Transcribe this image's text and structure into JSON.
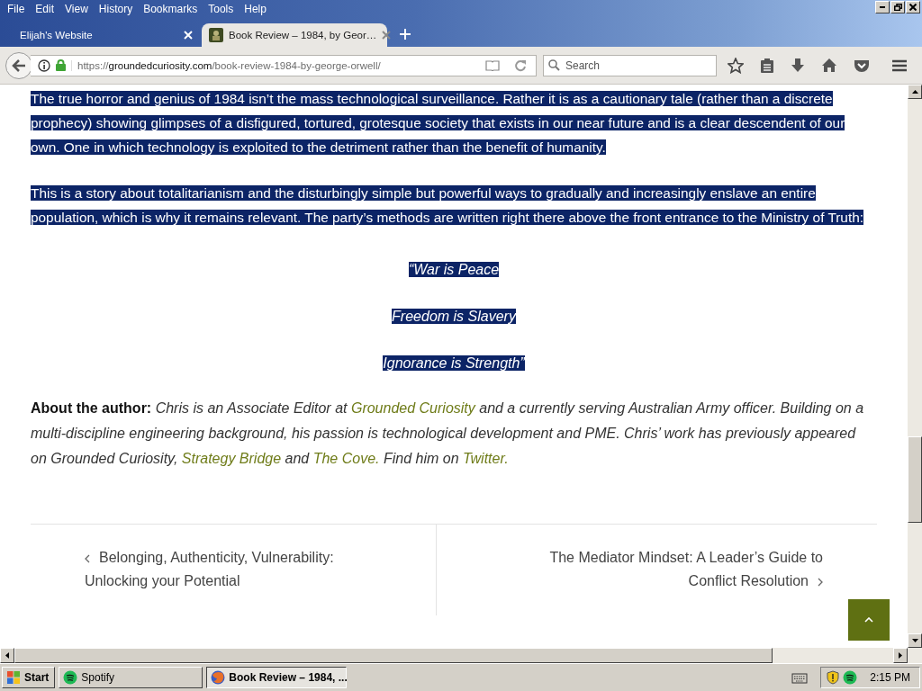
{
  "menu": [
    "File",
    "Edit",
    "View",
    "History",
    "Bookmarks",
    "Tools",
    "Help"
  ],
  "tabs": [
    {
      "title": "Elijah's Website",
      "selected": false
    },
    {
      "title": "Book Review – 1984, by Geor…",
      "selected": true
    }
  ],
  "address": {
    "scheme": "https://",
    "host": "groundedcuriosity.com",
    "path": "/book-review-1984-by-george-orwell/"
  },
  "search": {
    "placeholder": "Search"
  },
  "article": {
    "paragraphs": [
      {
        "text": "The true horror and genius of 1984 isn’t the mass technological surveillance. Rather it is as a cautionary tale (rather than a discrete prophecy) showing glimpses of a disfigured, tortured, grotesque society that exists in our near future and is a clear descendent of our own. One in which technology is exploited to the detriment rather than the benefit of humanity.",
        "highlighted": true
      },
      {
        "text": "This is a story about totalitarianism and the disturbingly simple but powerful ways to gradually and increasingly enslave an entire population, which is why it remains relevant. The party’s methods are written right there above the front entrance to the Ministry of Truth:",
        "highlighted": true
      }
    ],
    "quotes": [
      {
        "text": "“War is Peace",
        "highlighted": true
      },
      {
        "text": "Freedom is Slavery",
        "highlighted": true
      },
      {
        "text": "Ignorance is Strength”",
        "highlighted": true
      }
    ],
    "author": {
      "label": "About the author:",
      "bio": [
        {
          "kind": "text",
          "text": "Chris is an Associate Editor at "
        },
        {
          "kind": "link",
          "text": "Grounded Curiosity"
        },
        {
          "kind": "text",
          "text": " and a currently serving Australian Army officer. Building on a multi-discipline engineering background, his passion is technological development and PME. Chris’ work has previously appeared on Grounded Curiosity, "
        },
        {
          "kind": "link",
          "text": "Strategy Bridge"
        },
        {
          "kind": "text",
          "text": " and "
        },
        {
          "kind": "link",
          "text": "The Cove."
        },
        {
          "kind": "text",
          "text": "  Find him on "
        },
        {
          "kind": "link",
          "text": "Twitter."
        }
      ]
    }
  },
  "post_nav": {
    "previous": "Belonging, Authenticity, Vulnerability: Unlocking your Potential",
    "next": "The Mediator Mindset: A Leader’s Guide to Conflict Resolution"
  },
  "taskbar": {
    "start": "Start",
    "tasks": [
      {
        "title": "Spotify",
        "selected": false
      },
      {
        "title": "Book Review – 1984, ...",
        "selected": true
      }
    ],
    "clock": "2:15 PM"
  }
}
